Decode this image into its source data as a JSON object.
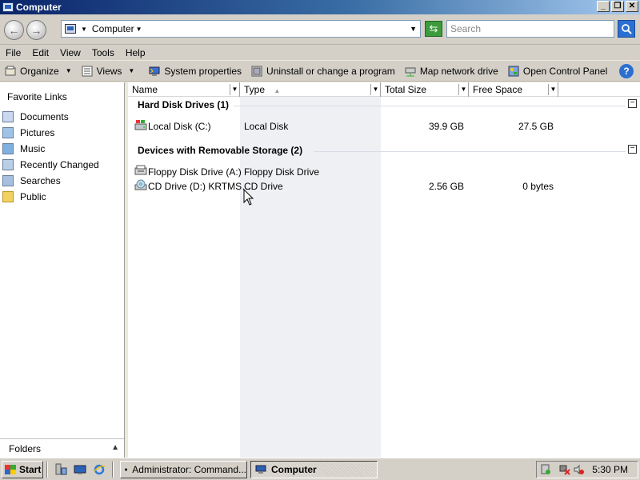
{
  "window": {
    "title": "Computer",
    "controls": [
      "_",
      "❐",
      "✕"
    ]
  },
  "address": {
    "path": "Computer",
    "search_placeholder": "Search"
  },
  "menu": [
    "File",
    "Edit",
    "View",
    "Tools",
    "Help"
  ],
  "toolbar": {
    "organize": "Organize",
    "views": "Views",
    "system_properties": "System properties",
    "uninstall": "Uninstall or change a program",
    "map_drive": "Map network drive",
    "control_panel": "Open Control Panel",
    "help": "?"
  },
  "sidebar": {
    "title": "Favorite Links",
    "items": [
      {
        "label": "Documents",
        "icon": "documents-icon"
      },
      {
        "label": "Pictures",
        "icon": "pictures-icon"
      },
      {
        "label": "Music",
        "icon": "music-icon"
      },
      {
        "label": "Recently Changed",
        "icon": "recently-changed-icon"
      },
      {
        "label": "Searches",
        "icon": "searches-icon"
      },
      {
        "label": "Public",
        "icon": "public-folder-icon"
      }
    ],
    "folders_label": "Folders"
  },
  "columns": [
    "Name",
    "Type",
    "Total Size",
    "Free Space"
  ],
  "groups": [
    {
      "title": "Hard Disk Drives (1)",
      "items": [
        {
          "name": "Local Disk (C:)",
          "type": "Local Disk",
          "total": "39.9 GB",
          "free": "27.5 GB"
        }
      ]
    },
    {
      "title": "Devices with Removable Storage (2)",
      "items": [
        {
          "name": "Floppy Disk Drive (A:)",
          "type": "Floppy Disk Drive",
          "total": "",
          "free": ""
        },
        {
          "name": "CD Drive (D:) KRTMS…",
          "type": "CD Drive",
          "total": "2.56 GB",
          "free": "0 bytes"
        }
      ]
    }
  ],
  "taskbar": {
    "start": "Start",
    "tasks": [
      {
        "label": "Administrator: Command...",
        "active": false
      },
      {
        "label": "Computer",
        "active": true
      }
    ],
    "clock": "5:30 PM"
  }
}
